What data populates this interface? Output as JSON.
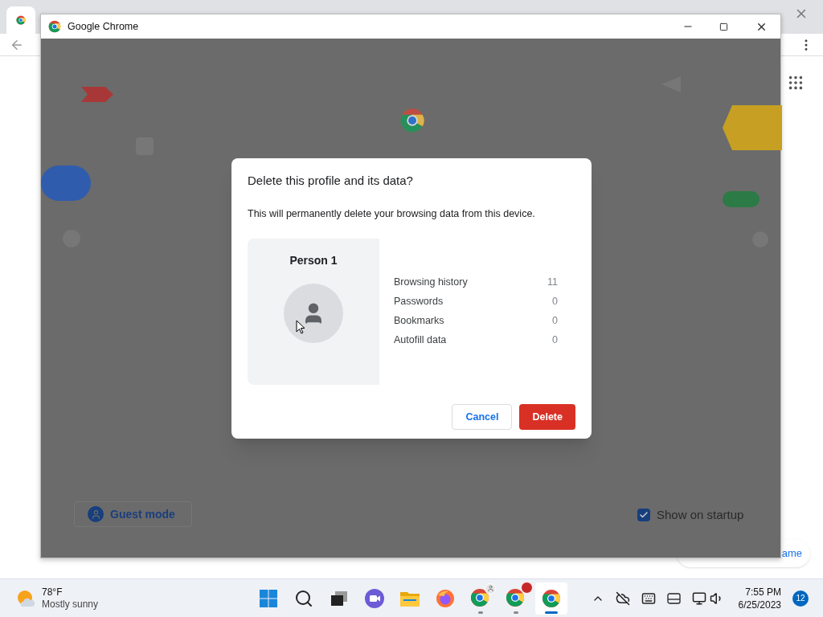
{
  "background_browser": {
    "corner_link": "ame"
  },
  "window": {
    "title": "Google Chrome"
  },
  "dialog": {
    "title": "Delete this profile and its data?",
    "message": "This will permanently delete your browsing data from this device.",
    "profile_name": "Person 1",
    "data_rows": [
      {
        "label": "Browsing history",
        "count": "11"
      },
      {
        "label": "Passwords",
        "count": "0"
      },
      {
        "label": "Bookmarks",
        "count": "0"
      },
      {
        "label": "Autofill data",
        "count": "0"
      }
    ],
    "buttons": [
      {
        "label": "Cancel",
        "kind": "secondary"
      },
      {
        "label": "Delete",
        "kind": "primary"
      }
    ]
  },
  "page_footer": {
    "guest_button": "Guest mode",
    "startup_checkbox": {
      "label": "Show on startup",
      "checked": true
    }
  },
  "taskbar": {
    "weather": {
      "temperature": "78°F",
      "condition": "Mostly sunny"
    },
    "apps": [
      {
        "kind": "start",
        "selected": false,
        "running": false
      },
      {
        "kind": "search",
        "selected": false,
        "running": false
      },
      {
        "kind": "taskview",
        "selected": false,
        "running": false
      },
      {
        "kind": "chat",
        "selected": false,
        "running": false
      },
      {
        "kind": "files",
        "selected": false,
        "running": false
      },
      {
        "kind": "firefox",
        "selected": false,
        "running": false
      },
      {
        "kind": "chrome-person",
        "selected": false,
        "running": true
      },
      {
        "kind": "chrome-badge",
        "selected": false,
        "running": true
      },
      {
        "kind": "chrome",
        "selected": true,
        "running": true
      }
    ],
    "clock": {
      "time": "7:55 PM",
      "date": "6/25/2023"
    },
    "notification_count": "12"
  }
}
